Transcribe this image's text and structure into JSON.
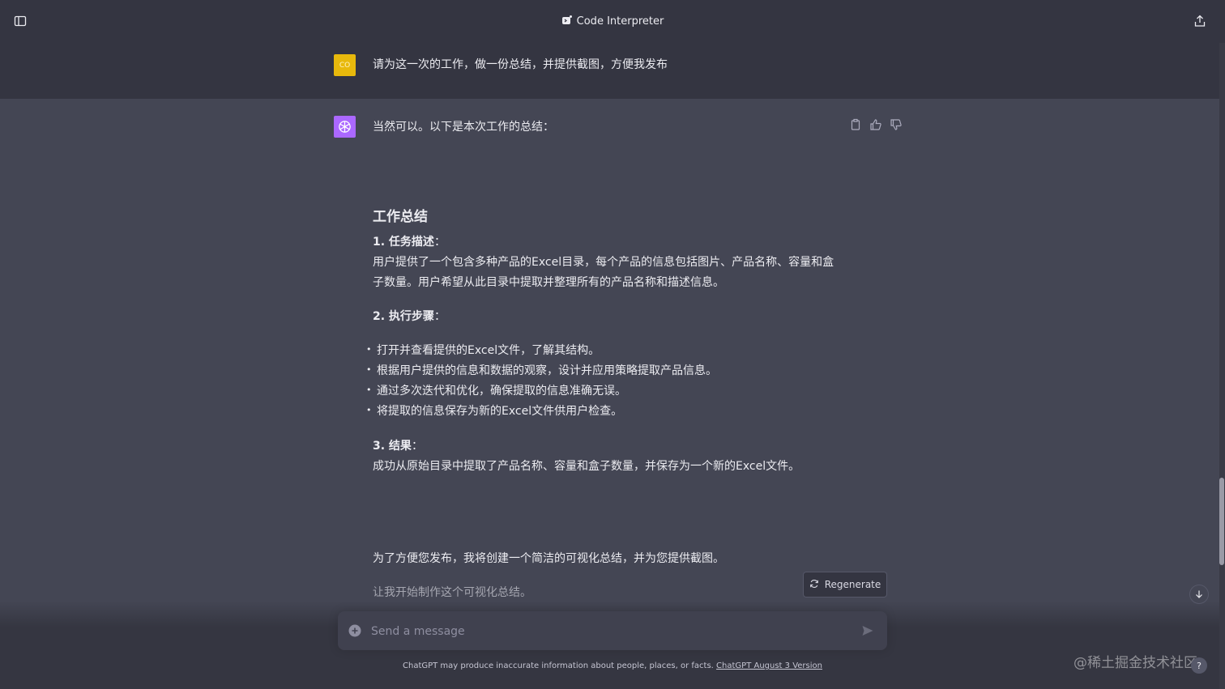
{
  "header": {
    "title": "Code Interpreter",
    "title_icon": "code-interpreter-icon",
    "left_icon": "sidebar-toggle-icon",
    "right_icon": "share-icon"
  },
  "user_message": {
    "avatar_text": "CO",
    "text": "请为这一次的工作，做一份总结，并提供截图，方便我发布"
  },
  "assistant_message": {
    "intro": "当然可以。以下是本次工作的总结：",
    "heading": "工作总结",
    "section1_title": "1. 任务描述",
    "section1_body_line1": "用户提供了一个包含多种产品的Excel目录，每个产品的信息包括图片、产品名称、容量和盒",
    "section1_body_line2": "子数量。用户希望从此目录中提取并整理所有的产品名称和描述信息。",
    "section2_title": "2. 执行步骤",
    "steps": [
      "打开并查看提供的Excel文件，了解其结构。",
      "根据用户提供的信息和数据的观察，设计并应用策略提取产品信息。",
      "通过多次迭代和优化，确保提取的信息准确无误。",
      "将提取的信息保存为新的Excel文件供用户检查。"
    ],
    "section3_title": "3. 结果",
    "section3_body": "成功从原始目录中提取了产品名称、容量和盒子数量，并保存为一个新的Excel文件。",
    "followup": "为了方便您发布，我将创建一个简洁的可视化总结，并为您提供截图。",
    "fading": "让我开始制作这个可视化总结。"
  },
  "colon": "：",
  "regenerate_label": "Regenerate",
  "composer": {
    "placeholder": "Send a message"
  },
  "footer": {
    "text": "ChatGPT may produce inaccurate information about people, places, or facts. ",
    "link": "ChatGPT August 3 Version"
  },
  "watermark": "@稀土掘金技术社区",
  "help_label": "?",
  "colors": {
    "background": "#444654",
    "header": "#343541",
    "user_avatar": "#e8b90c",
    "assistant_avatar": "#ab68ff"
  }
}
